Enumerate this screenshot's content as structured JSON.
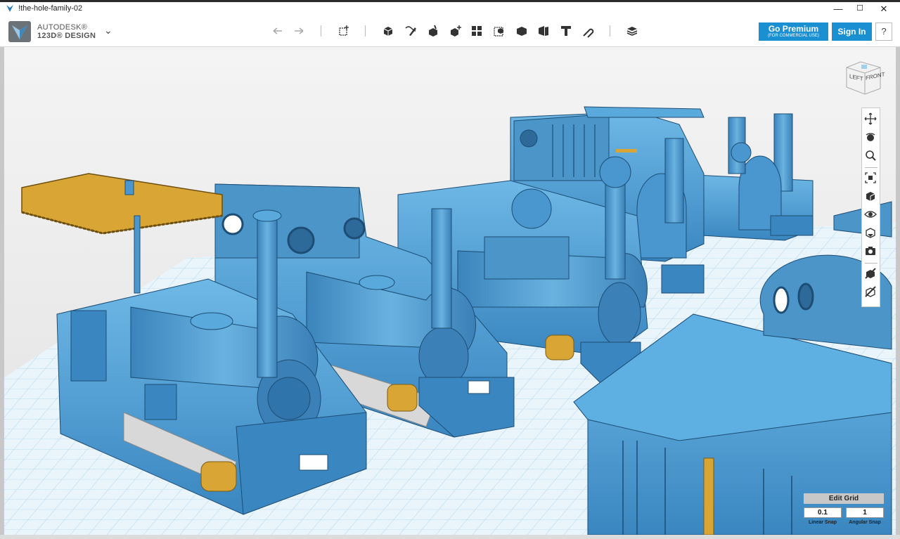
{
  "window": {
    "title": "!the-hole-family-02",
    "controls": {
      "minimize": "—",
      "maximize": "☐",
      "close": "✕"
    }
  },
  "brand": {
    "company": "AUTODESK®",
    "product": "123D® DESIGN",
    "menu_icon": "chevron-down-icon"
  },
  "toolbar": {
    "undo_icon": "undo-icon",
    "redo_icon": "redo-icon",
    "tools": [
      {
        "name": "transform",
        "icon": "transform-icon"
      },
      {
        "name": "primitives",
        "icon": "primitives-icon"
      },
      {
        "name": "sketch",
        "icon": "sketch-icon"
      },
      {
        "name": "construct",
        "icon": "construct-icon"
      },
      {
        "name": "modify",
        "icon": "modify-icon"
      },
      {
        "name": "pattern",
        "icon": "pattern-icon"
      },
      {
        "name": "group",
        "icon": "group-icon"
      },
      {
        "name": "combine",
        "icon": "combine-icon"
      },
      {
        "name": "measure",
        "icon": "measure-icon"
      },
      {
        "name": "text",
        "icon": "text-icon"
      },
      {
        "name": "snap",
        "icon": "snap-icon"
      },
      {
        "name": "material",
        "icon": "material-icon"
      }
    ]
  },
  "account": {
    "premium_label": "Go Premium",
    "premium_sub": "(FOR COMMERCIAL USE)",
    "signin_label": "Sign In",
    "help_label": "?"
  },
  "viewcube": {
    "left_label": "LEFT",
    "front_label": "FRONT"
  },
  "navbar": {
    "items": [
      "pan-icon",
      "orbit-icon",
      "zoom-icon",
      "fit-icon",
      "view-icon",
      "visibility-icon",
      "materials-outline-icon",
      "screenshot-icon",
      "hide-icon",
      "snap-toggle-icon"
    ]
  },
  "grid": {
    "edit_label": "Edit Grid",
    "linear_snap_value": "0.1",
    "angular_snap_value": "1",
    "linear_snap_label": "Linear Snap",
    "angular_snap_label": "Angular Snap",
    "grid_number": "300"
  },
  "colors": {
    "accent": "#1a8fd1",
    "model_blue": "#4b9fd4",
    "model_gold": "#d9a635"
  }
}
